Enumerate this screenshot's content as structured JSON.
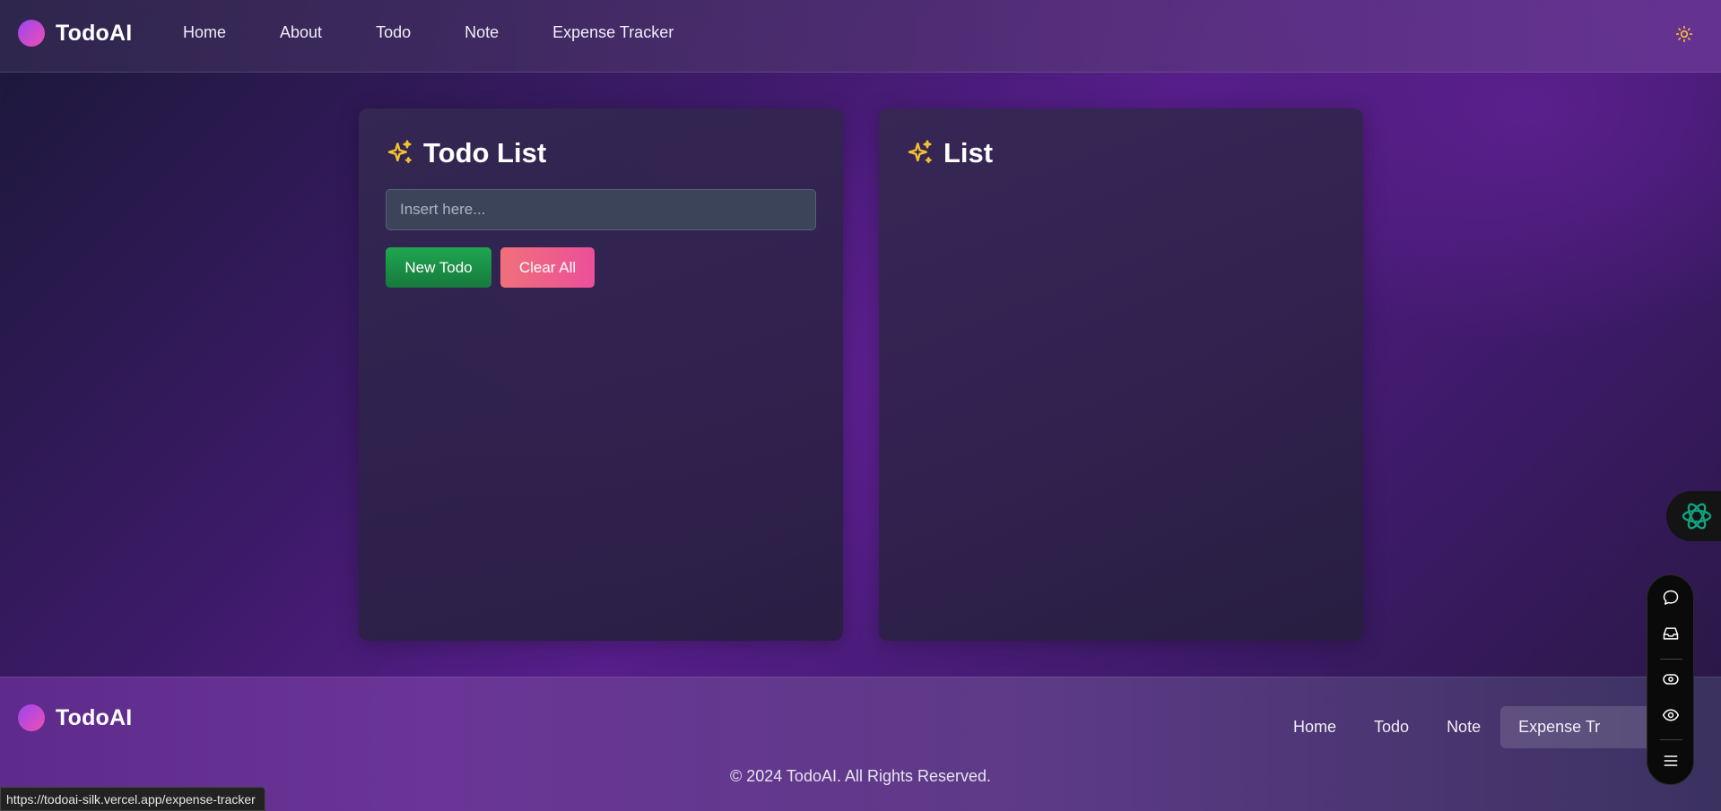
{
  "header": {
    "brand": "TodoAI",
    "nav": [
      "Home",
      "About",
      "Todo",
      "Note",
      "Expense Tracker"
    ],
    "theme_icon": "sun-icon"
  },
  "todo_card": {
    "title": "Todo List",
    "icon": "sparkles-icon",
    "input_placeholder": "Insert here...",
    "input_value": "",
    "new_button": "New Todo",
    "clear_button": "Clear All"
  },
  "list_card": {
    "title": "List",
    "icon": "sparkles-icon",
    "items": []
  },
  "footer": {
    "brand": "TodoAI",
    "links": [
      "Home",
      "Todo",
      "Note",
      "Expense Tr"
    ],
    "active_link": "Expense Tr",
    "copyright": "© 2024 TodoAI. All Rights Reserved."
  },
  "status_bar": {
    "url": "https://todoai-silk.vercel.app/expense-tracker"
  },
  "colors": {
    "accent_green": "#1fa650",
    "accent_pink": "#ec4f9a",
    "sparkle_yellow": "#f5c030",
    "gpt_green": "#10a37f"
  },
  "side_toolbar": {
    "icons": [
      "chat-icon",
      "inbox-icon",
      "eye-outline-icon",
      "eye-icon",
      "menu-icon"
    ]
  }
}
